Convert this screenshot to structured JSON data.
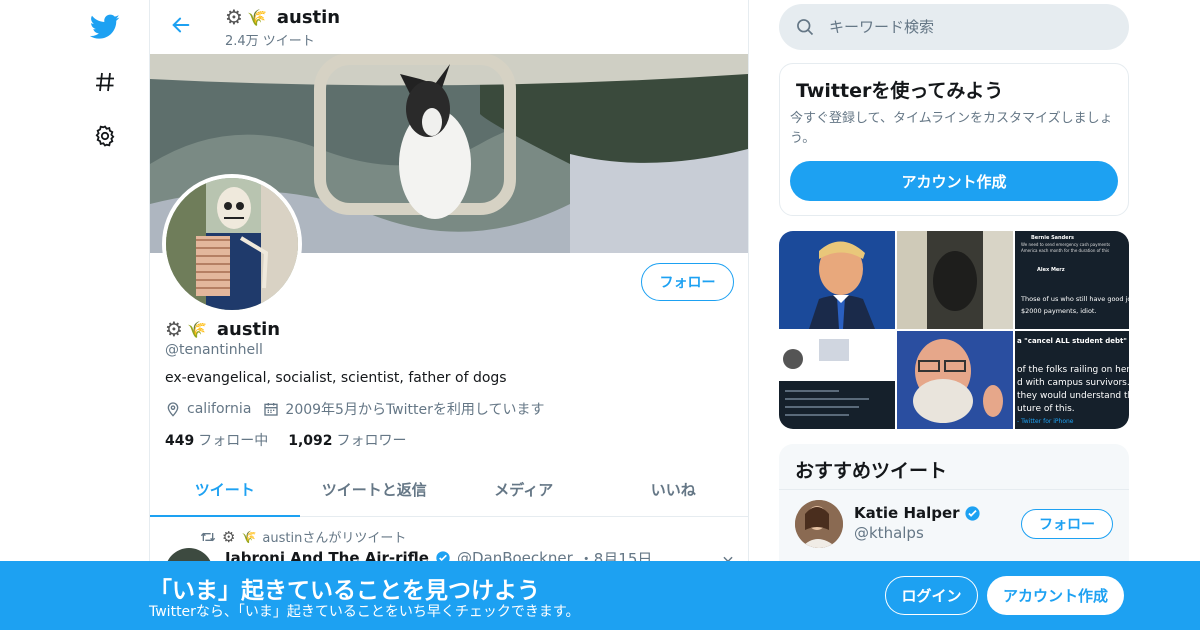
{
  "header": {
    "name": "austin",
    "tweet_count": "2.4万 ツイート"
  },
  "profile": {
    "name": "austin",
    "handle": "@tenantinhell",
    "bio": "ex-evangelical, socialist, scientist, father of dogs",
    "location": "california",
    "joined": "2009年5月からTwitterを利用しています",
    "following_count": "449",
    "following_label": "フォロー中",
    "followers_count": "1,092",
    "followers_label": "フォロワー",
    "follow_label": "フォロー"
  },
  "tabs": [
    {
      "label": "ツイート",
      "active": true
    },
    {
      "label": "ツイートと返信",
      "active": false
    },
    {
      "label": "メディア",
      "active": false
    },
    {
      "label": "いいね",
      "active": false
    }
  ],
  "timeline": {
    "retweet_label": "austinさんがリツイート",
    "tweet_author": "Jabroni And The Air-rifle",
    "tweet_handle": "@DanBoeckner",
    "tweet_date": "・8月15日"
  },
  "search": {
    "placeholder": "キーワード検索"
  },
  "signup_card": {
    "title": "Twitterを使ってみよう",
    "text": "今すぐ登録して、タイムラインをカスタマイズしましょう。",
    "button": "アカウント作成"
  },
  "media_thumbs": [
    {
      "label": "media-1"
    },
    {
      "label": "media-2"
    },
    {
      "label": "media-3",
      "lines": [
        "Bernie Sanders",
        "We need to send emergency cash payments",
        "America each month for the duration of this",
        "Alex Merz",
        "Those of us who still have good jobs",
        "$2000 payments, idiot."
      ]
    },
    {
      "label": "media-4"
    },
    {
      "label": "media-5"
    },
    {
      "label": "media-6",
      "lines": [
        "a \"cancel ALL student debt\" by...",
        "of the folks railing on here",
        "d with campus survivors.",
        "they would understand the",
        "uture of this.",
        "- Twitter for iPhone"
      ]
    }
  ],
  "recommended": {
    "title": "おすすめツイート",
    "user_name": "Katie Halper",
    "user_handle": "@kthalps",
    "follow_label": "フォロー"
  },
  "bottom_bar": {
    "title": "「いま」起きていることを見つけよう",
    "subtitle": "Twitterなら、「いま」起きていることをいち早くチェックできます。",
    "login": "ログイン",
    "signup": "アカウント作成"
  },
  "colors": {
    "accent": "#1da1f2",
    "muted": "#657786",
    "border": "#e6ecf0"
  }
}
